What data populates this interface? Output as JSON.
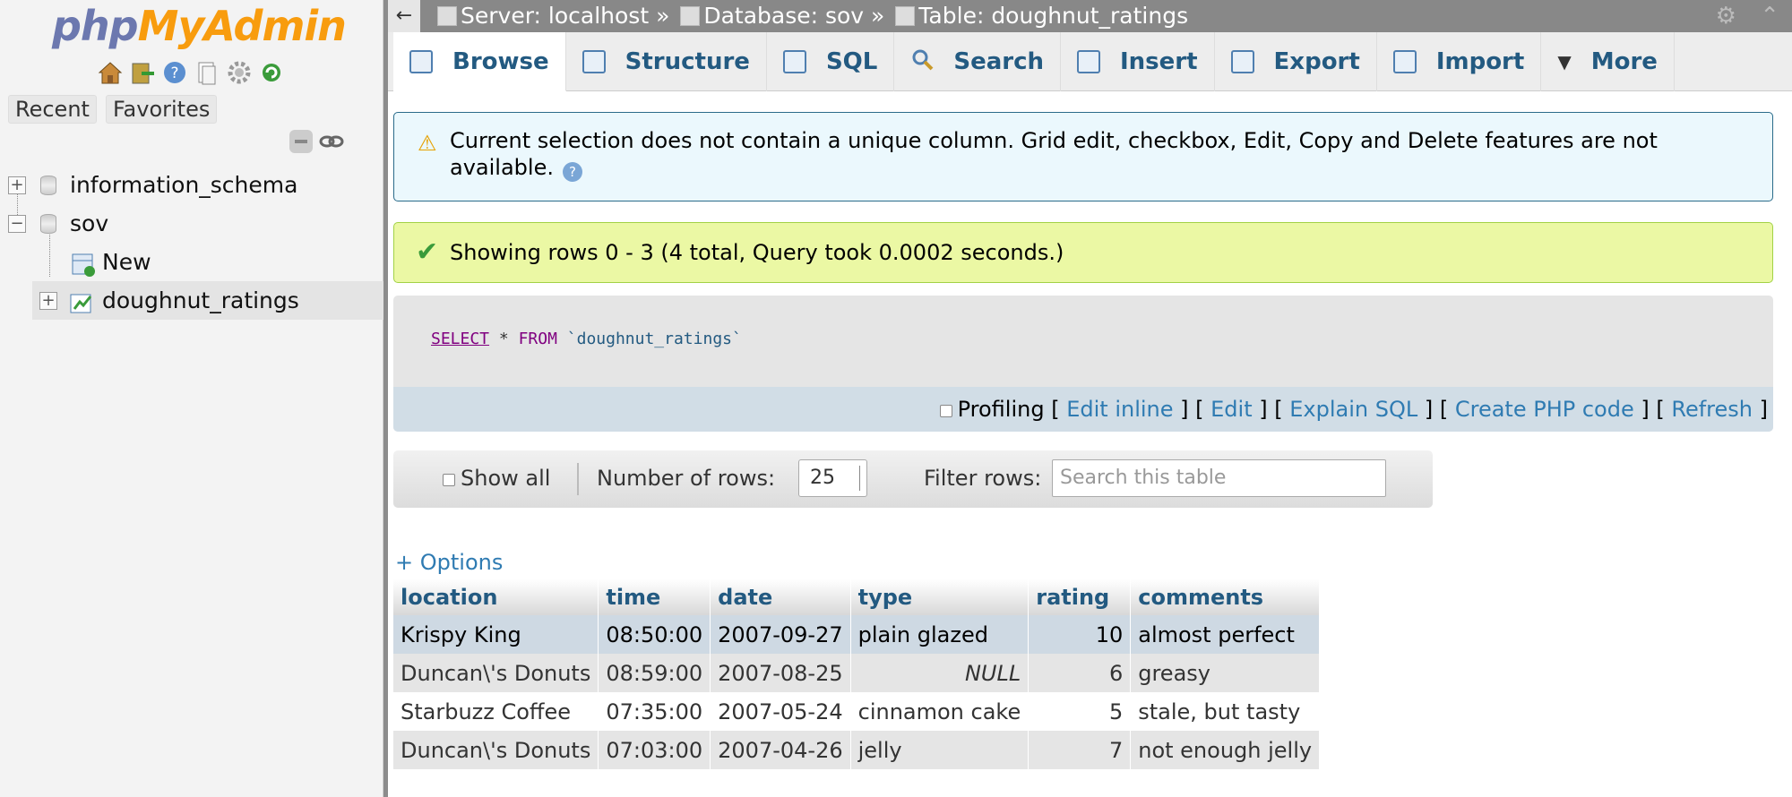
{
  "nav": {
    "logo_part1": "php",
    "logo_part2": "MyAdmin",
    "tabs": [
      "Recent",
      "Favorites"
    ],
    "tree": {
      "db1": "information_schema",
      "db2": "sov",
      "new": "New",
      "table": "doughnut_ratings"
    }
  },
  "topbar": {
    "back": "←",
    "server": "Server: localhost »",
    "database": "Database: sov »",
    "table": "Table: doughnut_ratings"
  },
  "tabs": [
    "Browse",
    "Structure",
    "SQL",
    "Search",
    "Insert",
    "Export",
    "Import",
    "More"
  ],
  "notices": {
    "warning": "Current selection does not contain a unique column. Grid edit, checkbox, Edit, Copy and Delete features are not available.",
    "success": "Showing rows 0 - 3 (4 total, Query took 0.0002 seconds.)"
  },
  "sql": {
    "select": "SELECT",
    "star": "*",
    "from": "FROM",
    "table": "`doughnut_ratings`",
    "profiling": "Profiling",
    "links": [
      "Edit inline",
      "Edit",
      "Explain SQL",
      "Create PHP code",
      "Refresh"
    ]
  },
  "navctl": {
    "show_all": "Show all",
    "rows_label": "Number of rows:",
    "rows_value": "25",
    "filter_label": "Filter rows:",
    "filter_placeholder": "Search this table"
  },
  "options_link": "+ Options",
  "table": {
    "columns": [
      "location",
      "time",
      "date",
      "type",
      "rating",
      "comments"
    ],
    "rows": [
      [
        "Krispy King",
        "08:50:00",
        "2007-09-27",
        "plain glazed",
        "10",
        "almost perfect"
      ],
      [
        "Duncan\\'s Donuts",
        "08:59:00",
        "2007-08-25",
        "NULL",
        "6",
        "greasy"
      ],
      [
        "Starbuzz Coffee",
        "07:35:00",
        "2007-05-24",
        "cinnamon cake",
        "5",
        "stale, but tasty"
      ],
      [
        "Duncan\\'s Donuts",
        "07:03:00",
        "2007-04-26",
        "jelly",
        "7",
        "not enough jelly"
      ]
    ]
  }
}
